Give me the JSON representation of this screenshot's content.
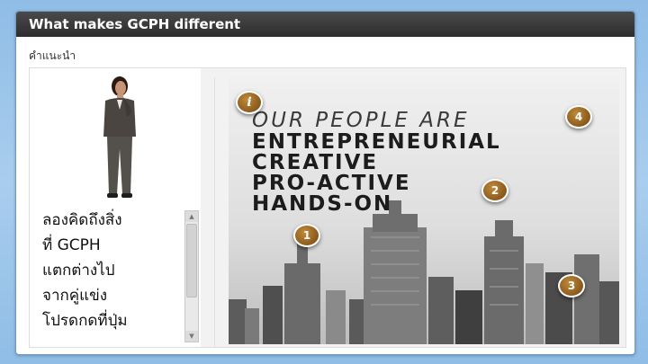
{
  "window": {
    "title": "What makes GCPH different"
  },
  "subtitle": "คำแนะนำ",
  "left_panel": {
    "text_lines": [
      "ลองคิดถึงสิ่ง",
      "ที่ GCPH",
      "แตกต่างไป",
      "จากคู่แข่ง",
      "โปรดกดที่ปุ่ม"
    ]
  },
  "image_panel": {
    "line1": "OUR PEOPLE ARE",
    "line2": "ENTREPRENEURIAL",
    "line3": "CREATIVE",
    "line4": "PRO-ACTIVE",
    "line5": "HANDS-ON",
    "markers": {
      "info": "i",
      "m1": "1",
      "m2": "2",
      "m3": "3",
      "m4": "4"
    }
  },
  "colors": {
    "title_bar": "#333333",
    "marker": "#a06e2a",
    "background": "#a9cdee"
  }
}
